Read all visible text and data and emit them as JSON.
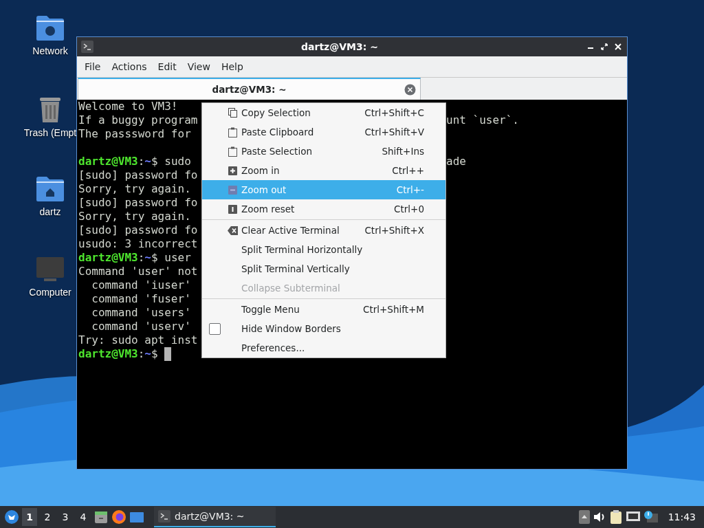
{
  "desktop_icons": [
    {
      "label": "Network"
    },
    {
      "label": "Trash (Empt"
    },
    {
      "label": "dartz"
    },
    {
      "label": "Computer"
    }
  ],
  "window": {
    "title": "dartz@VM3: ~",
    "menu_bar": [
      "File",
      "Actions",
      "Edit",
      "View",
      "Help"
    ],
    "tabs": [
      {
        "label": "dartz@VM3: ~",
        "selected": true
      }
    ],
    "terminal": {
      "lines": [
        [
          {
            "kind": "text",
            "text": "Welcome to VM3!"
          }
        ],
        [
          {
            "kind": "text",
            "text": "If a buggy program"
          }
        ],
        [
          {
            "kind": "text",
            "text": "The passsword for"
          }
        ],
        [
          {
            "kind": "blank"
          }
        ],
        [
          {
            "kind": "user",
            "text": "dartz@VM3"
          },
          {
            "kind": "text",
            "text": ":"
          },
          {
            "kind": "path",
            "text": "~"
          },
          {
            "kind": "text",
            "text": "$ sudo"
          }
        ],
        [
          {
            "kind": "text",
            "text": "[sudo] password fo"
          }
        ],
        [
          {
            "kind": "text",
            "text": "Sorry, try again."
          }
        ],
        [
          {
            "kind": "text",
            "text": "[sudo] password fo"
          }
        ],
        [
          {
            "kind": "text",
            "text": "Sorry, try again."
          }
        ],
        [
          {
            "kind": "text",
            "text": "[sudo] password fo"
          }
        ],
        [
          {
            "kind": "text",
            "text": "usudo: 3 incorrect"
          }
        ],
        [
          {
            "kind": "user",
            "text": "dartz@VM3"
          },
          {
            "kind": "text",
            "text": ":"
          },
          {
            "kind": "path",
            "text": "~"
          },
          {
            "kind": "text",
            "text": "$ user"
          }
        ],
        [
          {
            "kind": "text",
            "text": "Command 'user' not"
          }
        ],
        [
          {
            "kind": "text",
            "text": "  command 'iuser'"
          }
        ],
        [
          {
            "kind": "text",
            "text": "  command 'fuser'"
          }
        ],
        [
          {
            "kind": "text",
            "text": "  command 'users'"
          }
        ],
        [
          {
            "kind": "text",
            "text": "  command 'userv'"
          }
        ],
        [
          {
            "kind": "text",
            "text": "Try: sudo apt inst"
          }
        ],
        [
          {
            "kind": "user",
            "text": "dartz@VM3"
          },
          {
            "kind": "text",
            "text": ":"
          },
          {
            "kind": "path",
            "text": "~"
          },
          {
            "kind": "text",
            "text": "$ "
          },
          {
            "kind": "cursor"
          }
        ]
      ],
      "right_lines": [
        {
          "kind": "blank"
        },
        {
          "kind": "text",
          "text": "unt `user`."
        },
        {
          "kind": "blank"
        },
        {
          "kind": "blank"
        },
        {
          "kind": "text",
          "text": "ade"
        }
      ]
    },
    "context_menu": {
      "sections": [
        [
          {
            "kind": "action",
            "label": "Copy Selection",
            "shortcut": "Ctrl+Shift+C",
            "selected": false,
            "disabled": false
          },
          {
            "kind": "action",
            "label": "Paste Clipboard",
            "shortcut": "Ctrl+Shift+V",
            "selected": false,
            "disabled": false
          },
          {
            "kind": "action",
            "label": "Paste Selection",
            "shortcut": "Shift+Ins",
            "selected": false,
            "disabled": false
          },
          {
            "kind": "action",
            "label": "Zoom in",
            "shortcut": "Ctrl++",
            "selected": false,
            "disabled": false
          },
          {
            "kind": "action",
            "label": "Zoom out",
            "shortcut": "Ctrl+-",
            "selected": true,
            "disabled": false
          },
          {
            "kind": "action",
            "label": "Zoom reset",
            "shortcut": "Ctrl+0",
            "selected": false,
            "disabled": false
          }
        ],
        [
          {
            "kind": "action",
            "label": "Clear Active Terminal",
            "shortcut": "Ctrl+Shift+X",
            "selected": false,
            "disabled": false
          },
          {
            "kind": "action",
            "label": "Split Terminal Horizontally",
            "selected": false,
            "disabled": false
          },
          {
            "kind": "action",
            "label": "Split Terminal Vertically",
            "selected": false,
            "disabled": false
          },
          {
            "kind": "action",
            "label": "Collapse Subterminal",
            "selected": false,
            "disabled": true
          }
        ],
        [
          {
            "kind": "action",
            "label": "Toggle Menu",
            "shortcut": "Ctrl+Shift+M",
            "selected": false,
            "disabled": false
          },
          {
            "kind": "check",
            "label": "Hide Window Borders",
            "checked": false,
            "selected": false,
            "disabled": false
          },
          {
            "kind": "action",
            "label": "Preferences...",
            "selected": false,
            "disabled": false
          }
        ]
      ]
    }
  },
  "taskbar": {
    "workspaces": [
      {
        "label": "1",
        "selected": true
      },
      {
        "label": "2",
        "selected": false
      },
      {
        "label": "3",
        "selected": false
      },
      {
        "label": "4",
        "selected": false
      }
    ],
    "tasks": [
      {
        "label": "dartz@VM3: ~",
        "selected": true
      }
    ],
    "clock": "11:43"
  }
}
